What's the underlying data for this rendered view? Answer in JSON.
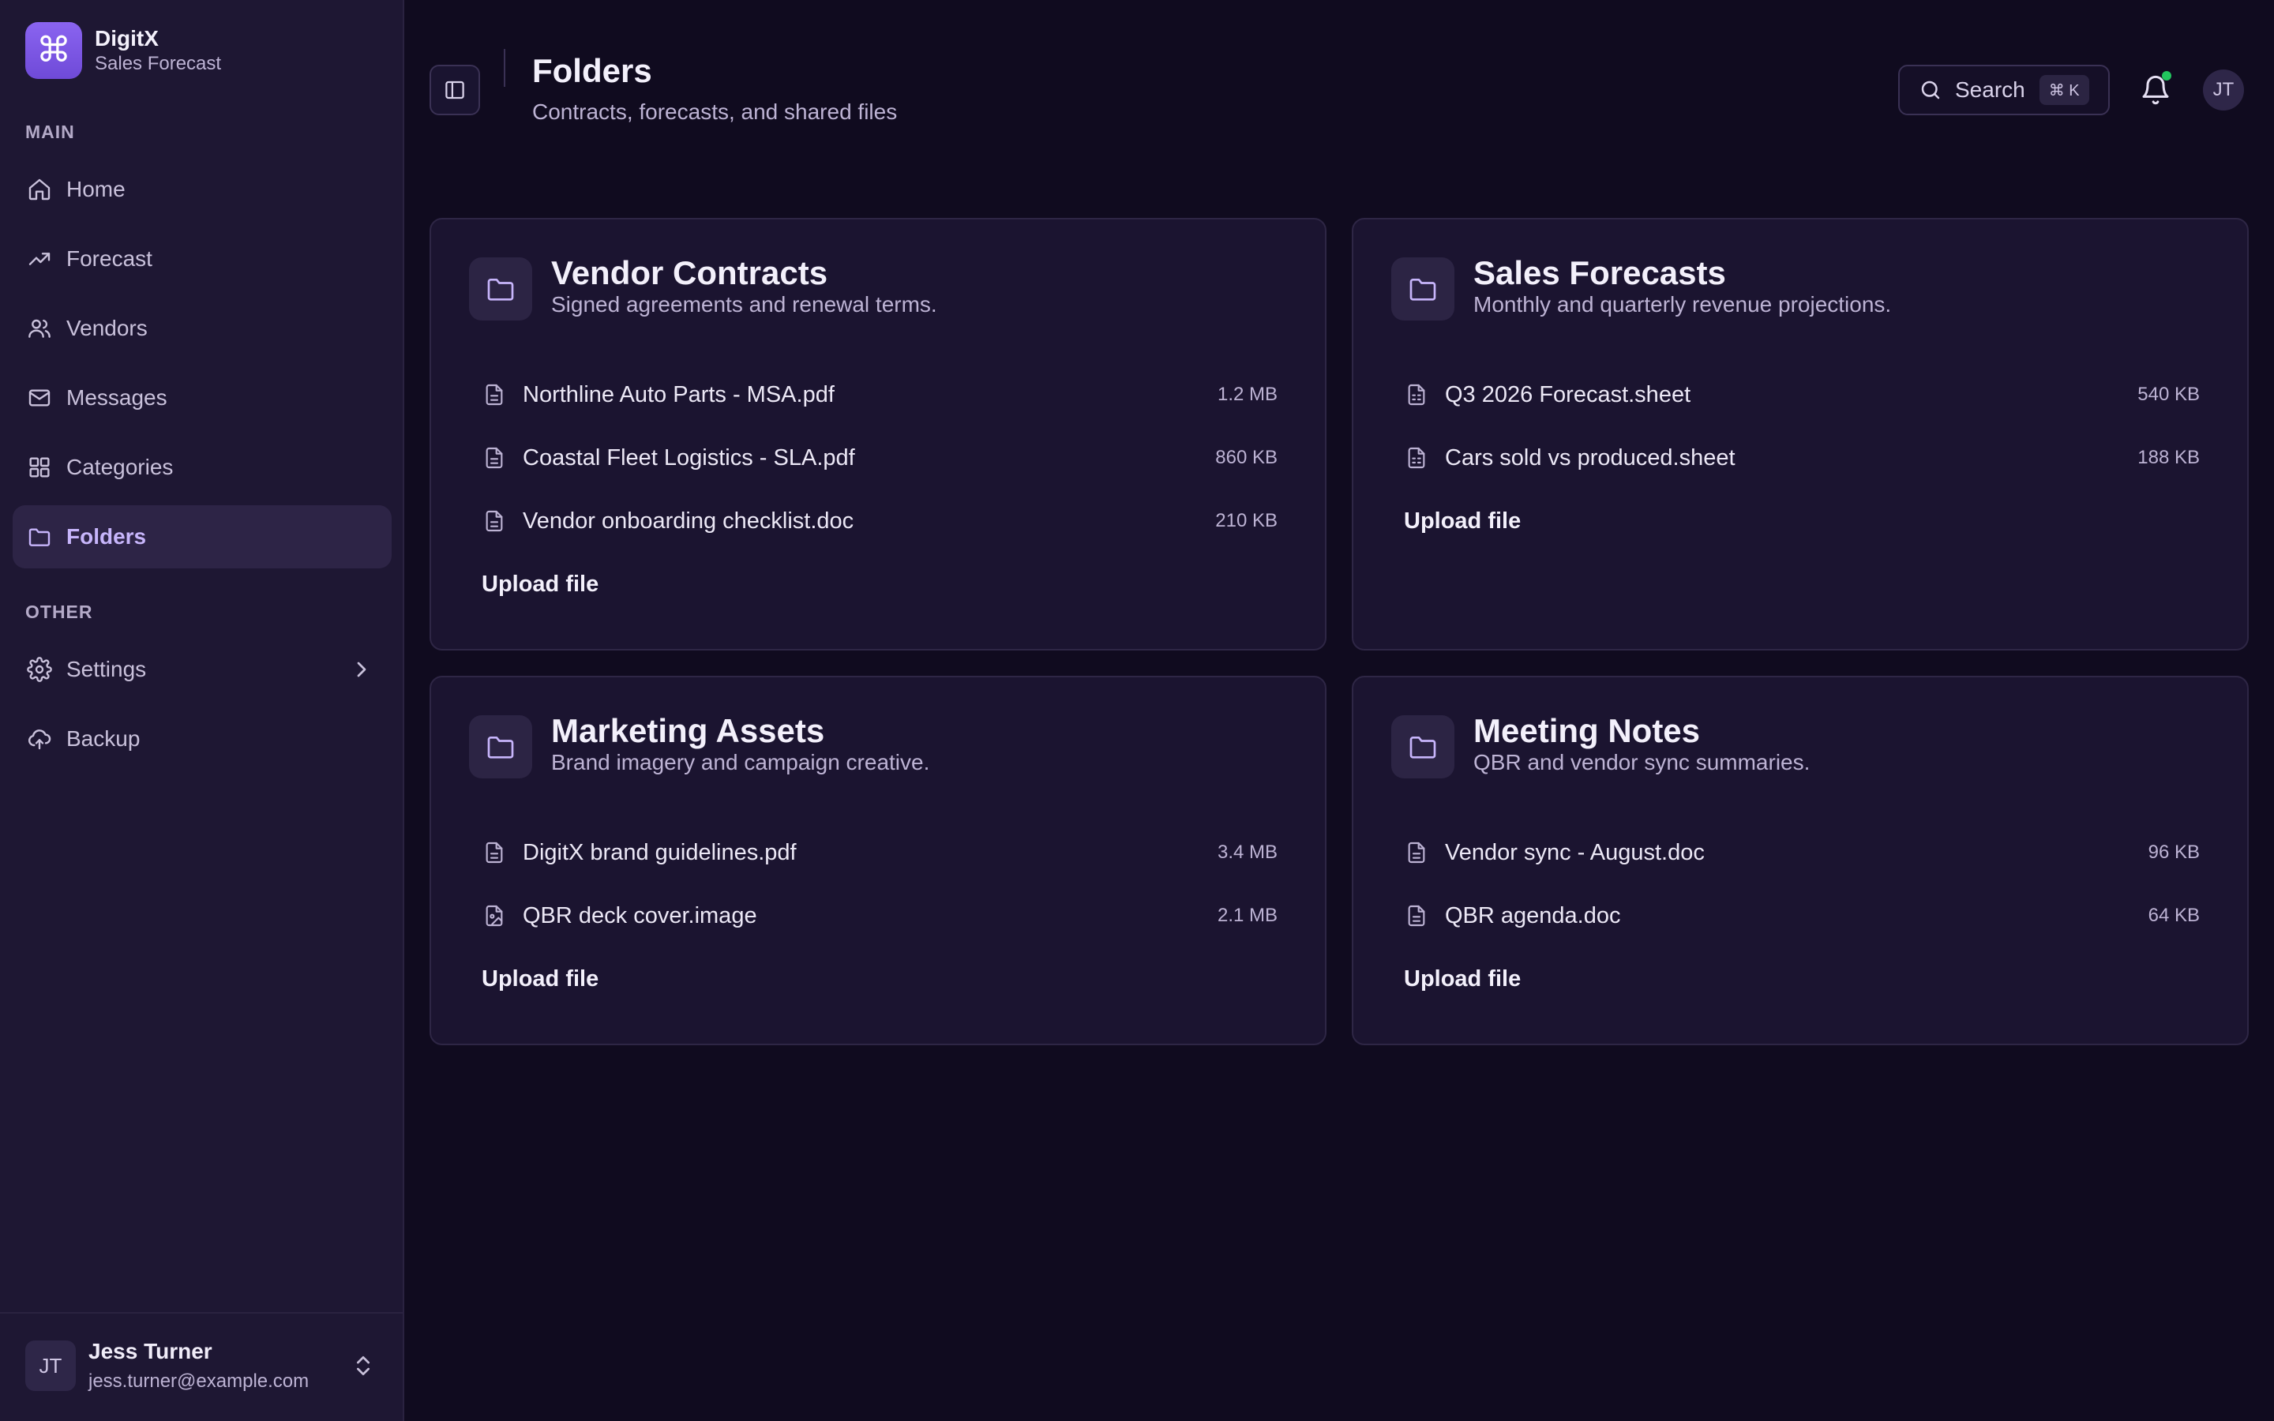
{
  "brand": {
    "name": "DigitX",
    "subtitle": "Sales Forecast",
    "logo_icon": "command-icon"
  },
  "sidebar": {
    "main_label": "MAIN",
    "other_label": "OTHER",
    "main_items": [
      {
        "label": "Home",
        "icon": "home-icon"
      },
      {
        "label": "Forecast",
        "icon": "trending-up-icon"
      },
      {
        "label": "Vendors",
        "icon": "users-icon"
      },
      {
        "label": "Messages",
        "icon": "mail-icon"
      },
      {
        "label": "Categories",
        "icon": "grid-icon"
      },
      {
        "label": "Folders",
        "icon": "folder-icon",
        "active": true
      }
    ],
    "other_items": [
      {
        "label": "Settings",
        "icon": "gear-icon"
      },
      {
        "label": "Backup",
        "icon": "cloud-upload-icon"
      }
    ]
  },
  "user": {
    "initials": "JT",
    "name": "Jess Turner",
    "email": "jess.turner@example.com"
  },
  "header": {
    "title": "Folders",
    "subtitle": "Contracts, forecasts, and shared files",
    "search_label": "Search",
    "search_shortcut": "⌘ K",
    "avatar_initials": "JT"
  },
  "folders": [
    {
      "title": "Vendor Contracts",
      "description": "Signed agreements and renewal terms.",
      "files": [
        {
          "name": "Northline Auto Parts - MSA.pdf",
          "size": "1.2 MB",
          "icon": "file-text-icon"
        },
        {
          "name": "Coastal Fleet Logistics - SLA.pdf",
          "size": "860 KB",
          "icon": "file-text-icon"
        },
        {
          "name": "Vendor onboarding checklist.doc",
          "size": "210 KB",
          "icon": "file-text-icon"
        }
      ],
      "upload_label": "Upload file"
    },
    {
      "title": "Sales Forecasts",
      "description": "Monthly and quarterly revenue projections.",
      "files": [
        {
          "name": "Q3 2026 Forecast.sheet",
          "size": "540 KB",
          "icon": "file-spreadsheet-icon"
        },
        {
          "name": "Cars sold vs produced.sheet",
          "size": "188 KB",
          "icon": "file-spreadsheet-icon"
        }
      ],
      "upload_label": "Upload file"
    },
    {
      "title": "Marketing Assets",
      "description": "Brand imagery and campaign creative.",
      "files": [
        {
          "name": "DigitX brand guidelines.pdf",
          "size": "3.4 MB",
          "icon": "file-text-icon"
        },
        {
          "name": "QBR deck cover.image",
          "size": "2.1 MB",
          "icon": "file-image-icon"
        }
      ],
      "upload_label": "Upload file"
    },
    {
      "title": "Meeting Notes",
      "description": "QBR and vendor sync summaries.",
      "files": [
        {
          "name": "Vendor sync - August.doc",
          "size": "96 KB",
          "icon": "file-text-icon"
        },
        {
          "name": "QBR agenda.doc",
          "size": "64 KB",
          "icon": "file-text-icon"
        }
      ],
      "upload_label": "Upload file"
    }
  ],
  "colors": {
    "background": "#100b1f",
    "sidebar": "#1e1733",
    "card": "#1b1430",
    "accent": "#c7b5fb",
    "brand": "#7c58e4",
    "notification_dot": "#22c55e"
  }
}
